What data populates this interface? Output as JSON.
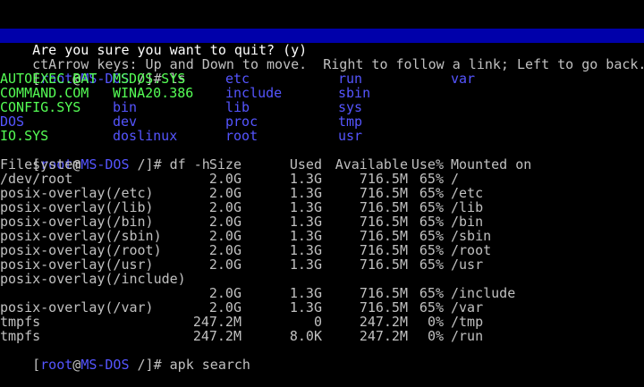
{
  "window_title": "",
  "banner": {
    "question": "Are you sure you want to quit? (y)"
  },
  "help_line": "ctArrow keys: Up and Down to move.  Right to follow a link; Left to go back.",
  "prompt": {
    "open": "[",
    "user": "root",
    "at": "@",
    "host": "MS-DOS",
    "path": " /]# "
  },
  "commands": {
    "ls": "ls",
    "df": "df -h",
    "apk": "apk search"
  },
  "ls_columns": [
    [
      {
        "name": "AUTOEXEC.BAT",
        "kind": "exec"
      },
      {
        "name": "COMMAND.COM",
        "kind": "exec"
      },
      {
        "name": "CONFIG.SYS",
        "kind": "exec"
      },
      {
        "name": "DOS",
        "kind": "dir"
      },
      {
        "name": "IO.SYS",
        "kind": "exec"
      }
    ],
    [
      {
        "name": "MSDOS.SYS",
        "kind": "exec"
      },
      {
        "name": "WINA20.386",
        "kind": "exec"
      },
      {
        "name": "bin",
        "kind": "dir"
      },
      {
        "name": "dev",
        "kind": "dir"
      },
      {
        "name": "doslinux",
        "kind": "dir"
      }
    ],
    [
      {
        "name": "etc",
        "kind": "dir"
      },
      {
        "name": "include",
        "kind": "dir"
      },
      {
        "name": "lib",
        "kind": "dir"
      },
      {
        "name": "proc",
        "kind": "dir"
      },
      {
        "name": "root",
        "kind": "dir"
      }
    ],
    [
      {
        "name": "run",
        "kind": "dir"
      },
      {
        "name": "sbin",
        "kind": "dir"
      },
      {
        "name": "sys",
        "kind": "dir"
      },
      {
        "name": "tmp",
        "kind": "dir"
      },
      {
        "name": "usr",
        "kind": "dir"
      }
    ],
    [
      {
        "name": "var",
        "kind": "dir"
      }
    ]
  ],
  "df": {
    "headers": {
      "filesystem": "Filesystem",
      "size": "Size",
      "used": "Used",
      "avail": "Available",
      "use": "Use%",
      "mount": "Mounted on"
    },
    "rows": [
      {
        "fs": "/dev/root",
        "size": "2.0G",
        "used": "1.3G",
        "avail": "716.5M",
        "use": "65%",
        "mount": "/"
      },
      {
        "fs": "posix-overlay(/etc)",
        "size": "2.0G",
        "used": "1.3G",
        "avail": "716.5M",
        "use": "65%",
        "mount": "/etc"
      },
      {
        "fs": "posix-overlay(/lib)",
        "size": "2.0G",
        "used": "1.3G",
        "avail": "716.5M",
        "use": "65%",
        "mount": "/lib"
      },
      {
        "fs": "posix-overlay(/bin)",
        "size": "2.0G",
        "used": "1.3G",
        "avail": "716.5M",
        "use": "65%",
        "mount": "/bin"
      },
      {
        "fs": "posix-overlay(/sbin)",
        "size": "2.0G",
        "used": "1.3G",
        "avail": "716.5M",
        "use": "65%",
        "mount": "/sbin"
      },
      {
        "fs": "posix-overlay(/root)",
        "size": "2.0G",
        "used": "1.3G",
        "avail": "716.5M",
        "use": "65%",
        "mount": "/root"
      },
      {
        "fs": "posix-overlay(/usr)",
        "size": "2.0G",
        "used": "1.3G",
        "avail": "716.5M",
        "use": "65%",
        "mount": "/usr"
      },
      {
        "fs": "posix-overlay(/include)",
        "size": "",
        "used": "",
        "avail": "",
        "use": "",
        "mount": ""
      },
      {
        "fs": "",
        "size": "2.0G",
        "used": "1.3G",
        "avail": "716.5M",
        "use": "65%",
        "mount": "/include"
      },
      {
        "fs": "posix-overlay(/var)",
        "size": "2.0G",
        "used": "1.3G",
        "avail": "716.5M",
        "use": "65%",
        "mount": "/var"
      },
      {
        "fs": "tmpfs",
        "size": "247.2M",
        "used": "0",
        "avail": "247.2M",
        "use": "0%",
        "mount": "/tmp"
      },
      {
        "fs": "tmpfs",
        "size": "247.2M",
        "used": "8.0K",
        "avail": "247.2M",
        "use": "0%",
        "mount": "/run"
      }
    ]
  },
  "colors": {
    "background": "#000000",
    "banner_bg": "#0000aa",
    "text": "#c0c0c0",
    "exec": "#55ff55",
    "dir": "#5555ff"
  }
}
